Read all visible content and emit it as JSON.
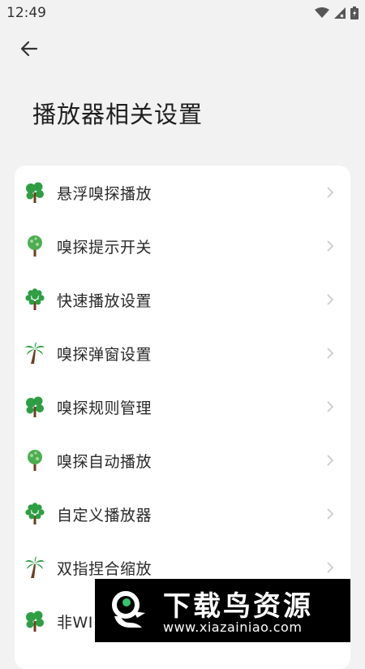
{
  "status_bar": {
    "time": "12:49"
  },
  "header": {
    "title": "播放器相关设置"
  },
  "settings": {
    "items": [
      {
        "label": "悬浮嗅探播放",
        "icon": "clover-tree-icon"
      },
      {
        "label": "嗅探提示开关",
        "icon": "round-tree-icon"
      },
      {
        "label": "快速播放设置",
        "icon": "dotted-tree-icon"
      },
      {
        "label": "嗅探弹窗设置",
        "icon": "palm-tree-icon"
      },
      {
        "label": "嗅探规则管理",
        "icon": "clover-tree-icon"
      },
      {
        "label": "嗅探自动播放",
        "icon": "round-tree-icon"
      },
      {
        "label": "自定义播放器",
        "icon": "dotted-tree-icon"
      },
      {
        "label": "双指捏合缩放",
        "icon": "palm-tree-icon"
      },
      {
        "label": "非WI",
        "icon": "clover-tree-icon"
      }
    ]
  },
  "watermark": {
    "title": "下载鸟资源",
    "url": "www.xiazainiao.com"
  },
  "colors": {
    "background": "#f2f2f2",
    "card": "#ffffff",
    "tree_green": "#2e9e44",
    "trunk": "#6b3f1f"
  }
}
